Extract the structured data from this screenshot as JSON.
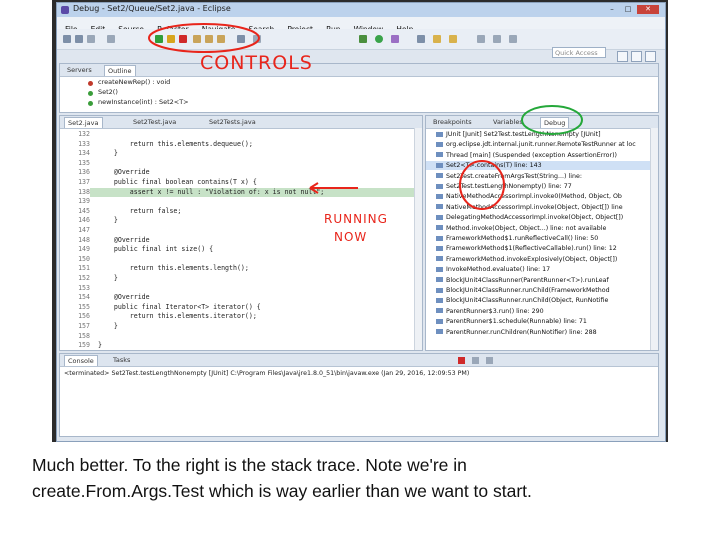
{
  "window": {
    "title": "Debug - Set2/Queue/Set2.java - Eclipse",
    "controls": [
      "–",
      "□",
      "✕"
    ]
  },
  "menu": [
    "File",
    "Edit",
    "Source",
    "Refactor",
    "Navigate",
    "Search",
    "Project",
    "Run",
    "Window",
    "Help"
  ],
  "quick_access": {
    "placeholder": "Quick Access"
  },
  "outline": {
    "tabs": [
      "Servers",
      "Outline"
    ],
    "rows": [
      "createNewRep() : void",
      "Set2()",
      "newInstance(int) : Set2<T>"
    ]
  },
  "editor": {
    "tabs": [
      "Set2.java",
      "Set2Test.java",
      "Set2Tests.java"
    ],
    "lines": [
      {
        "n": "132",
        "code": ""
      },
      {
        "n": "133",
        "code": "        return this.elements.dequeue();"
      },
      {
        "n": "134",
        "code": "    }"
      },
      {
        "n": "135",
        "code": ""
      },
      {
        "n": "136",
        "code": "    @Override"
      },
      {
        "n": "137",
        "code": "    public final boolean contains(T x) {"
      },
      {
        "n": "138",
        "code": "        assert x != null : \"Violation of: x is not null\";"
      },
      {
        "n": "139",
        "code": ""
      },
      {
        "n": "145",
        "code": "        return false;"
      },
      {
        "n": "146",
        "code": "    }"
      },
      {
        "n": "147",
        "code": ""
      },
      {
        "n": "148",
        "code": "    @Override"
      },
      {
        "n": "149",
        "code": "    public final int size() {"
      },
      {
        "n": "150",
        "code": ""
      },
      {
        "n": "151",
        "code": "        return this.elements.length();"
      },
      {
        "n": "152",
        "code": "    }"
      },
      {
        "n": "153",
        "code": ""
      },
      {
        "n": "154",
        "code": "    @Override"
      },
      {
        "n": "155",
        "code": "    public final Iterator<T> iterator() {"
      },
      {
        "n": "156",
        "code": "        return this.elements.iterator();"
      },
      {
        "n": "157",
        "code": "    }"
      },
      {
        "n": "158",
        "code": ""
      },
      {
        "n": "159",
        "code": "}"
      }
    ]
  },
  "debug": {
    "tabs": [
      "Breakpoints",
      "Variables",
      "Debug"
    ],
    "frames": [
      "JUnit [Junit] Set2Test.testLengthNonempty [JUnit]",
      "org.eclipse.jdt.internal.junit.runner.RemoteTestRunner at loc",
      "Thread [main] (Suspended (exception AssertionError))",
      "Set2<T>.contains(T) line: 143",
      "Set2Test.createFromArgsTest(String...) line:",
      "Set2Test.testLengthNonempty() line: 77",
      "NativeMethodAccessorImpl.invoke0(Method, Object, Ob",
      "NativeMethodAccessorImpl.invoke(Object, Object[]) line",
      "DelegatingMethodAccessorImpl.invoke(Object, Object[])",
      "Method.invoke(Object, Object...) line: not available",
      "FrameworkMethod$1.runReflectiveCall() line: 50",
      "FrameworkMethod$1(ReflectiveCallable).run() line: 12",
      "FrameworkMethod.invokeExplosively(Object, Object[])",
      "InvokeMethod.evaluate() line: 17",
      "BlockJUnit4ClassRunner(ParentRunner<T>).runLeaf",
      "BlockJUnit4ClassRunner.runChild(FrameworkMethod",
      "BlockJUnit4ClassRunner.runChild(Object, RunNotifie",
      "ParentRunner$3.run() line: 290",
      "ParentRunner$1.schedule(Runnable) line: 71",
      "ParentRunner.runChildren(RunNotifier) line: 288"
    ]
  },
  "console": {
    "tabs": [
      "Console",
      "Tasks"
    ],
    "line": "<terminated> Set2Test.testLengthNonempty [JUnit] C:\\Program Files\\Java\\jre1.8.0_51\\bin\\javaw.exe (Jan 29, 2016, 12:09:53 PM)"
  },
  "annotations": {
    "controls": "CONTROLS",
    "running_1": "RUNNING",
    "running_2": "NOW"
  },
  "caption": {
    "line1": "Much better.  To the right is the stack trace.  Note we're in",
    "line2": "create.From.Args.Test which is way earlier than we want to start."
  },
  "colors": {
    "annotation": "#e8251b",
    "highlight_circle": "#25a83a"
  }
}
